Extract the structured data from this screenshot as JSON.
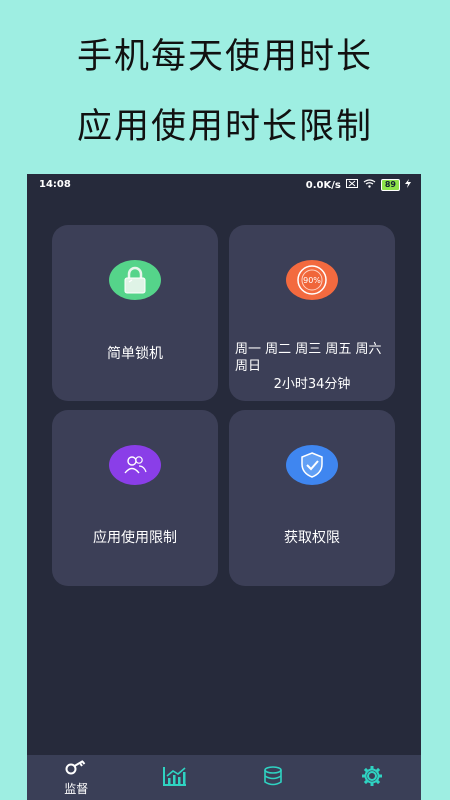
{
  "promo": {
    "line1": "手机每天使用时长",
    "line2": "应用使用时长限制"
  },
  "status": {
    "time": "14:08",
    "speed": "0.0K/s",
    "battery": "89"
  },
  "cards": [
    {
      "label": "简单锁机",
      "icon": "lock-icon",
      "color": "#55d48a"
    },
    {
      "days": "周一 周二 周三 周五 周六 周日",
      "duration": "2小时34分钟",
      "badge_text": "90%",
      "icon": "gauge-icon",
      "color": "#f36a3f"
    },
    {
      "label": "应用使用限制",
      "icon": "users-icon",
      "color": "#8a3ee8"
    },
    {
      "label": "获取权限",
      "icon": "shield-check-icon",
      "color": "#3f86f0"
    }
  ],
  "tabs": [
    {
      "label": "监督",
      "icon": "key-icon"
    },
    {
      "label": "",
      "icon": "chart-icon"
    },
    {
      "label": "",
      "icon": "database-icon"
    },
    {
      "label": "",
      "icon": "gear-icon"
    }
  ]
}
